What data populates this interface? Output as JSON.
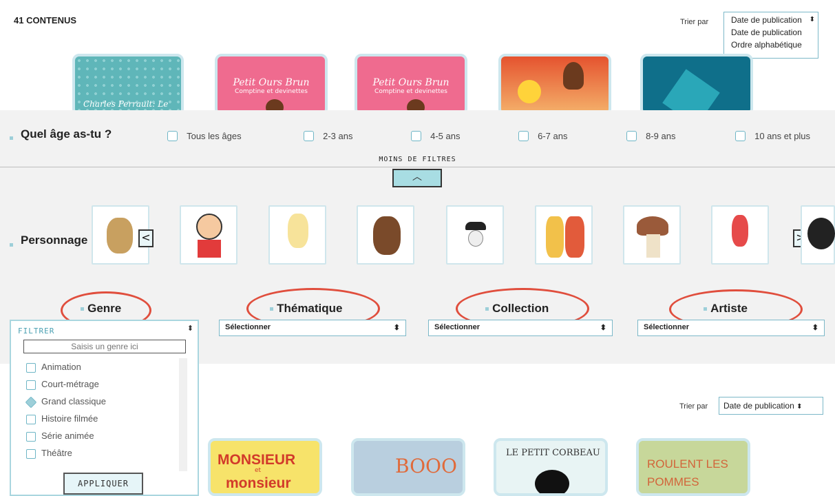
{
  "content_count": "41 CONTENUS",
  "sort_top": {
    "label": "Trier par",
    "selected": "Date de publication",
    "options": [
      "Date de publication",
      "Ordre alphabétique"
    ]
  },
  "age_filter": {
    "title": "Quel âge as-tu ?",
    "options": [
      "Tous les âges",
      "2-3 ans",
      "4-5 ans",
      "6-7 ans",
      "8-9 ans",
      "10 ans et plus"
    ]
  },
  "less_filters": "MOINS DE FILTRES",
  "characters": {
    "title": "Personnage",
    "prev": "<",
    "next": ">",
    "items": [
      "bear-drummer",
      "boy-red-shirt",
      "la-fee-fifolette",
      "indian-girl",
      "chaplin",
      "two-boys",
      "mushroom",
      "sansan-rabbit",
      "black-creature"
    ]
  },
  "categories": {
    "genre": {
      "title": "Genre"
    },
    "thematique": {
      "title": "Thématique",
      "select": "Sélectionner"
    },
    "collection": {
      "title": "Collection",
      "select": "Sélectionner"
    },
    "artiste": {
      "title": "Artiste",
      "select": "Sélectionner"
    }
  },
  "genre_dropdown": {
    "header": "FILTRER",
    "placeholder": "Saisis un genre ici",
    "options": [
      "Animation",
      "Court-métrage",
      "Grand classique",
      "Histoire filmée",
      "Série animée",
      "Théâtre"
    ],
    "checked": "Grand classique",
    "apply": "APPLIQUER"
  },
  "sort_bottom": {
    "label": "Trier par",
    "selected": "Date de publication"
  },
  "top_cards": [
    {
      "text": "Charles Perrault: Le petit"
    },
    {
      "text": "Petit Ours Brun",
      "sub": "Comptine et devinettes"
    },
    {
      "text": "Petit Ours Brun",
      "sub": "Comptine et devinettes"
    },
    {
      "text": ""
    },
    {
      "text": ""
    }
  ],
  "bottom_cards": [
    {
      "text": "MONSIEUR",
      "sub": "et",
      "text2": "monsieur"
    },
    {
      "text": "BOOO"
    },
    {
      "text": "LE PETIT CORBEAU"
    },
    {
      "text": "ROULENT LES",
      "text2": "POMMES"
    }
  ],
  "colors": {
    "accent": "#9dcfd9",
    "oval": "#e04e3d",
    "band": "#f2f2f2"
  }
}
